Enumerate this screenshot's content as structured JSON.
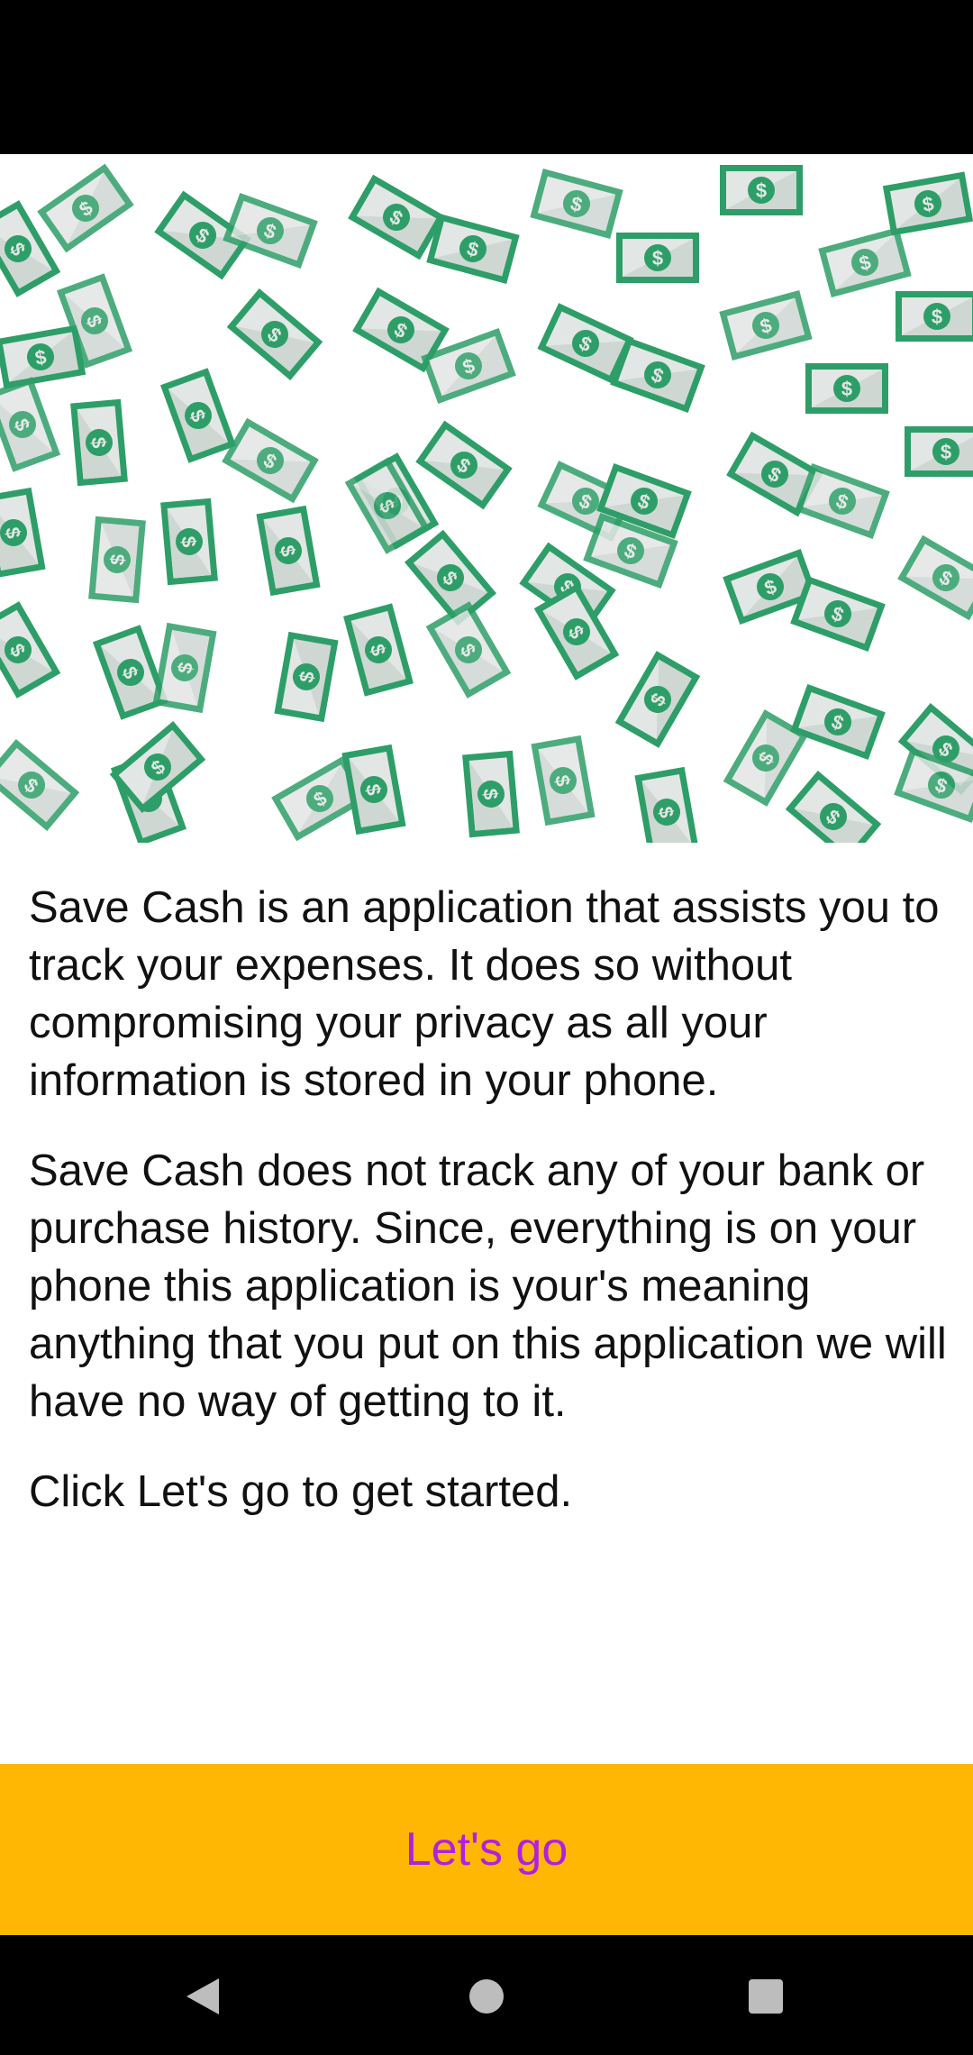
{
  "status_bar": {},
  "hero": {
    "illustration": "money-bills-illustration",
    "bill_symbol": "$",
    "colors": {
      "bill_green": "#2E9E68",
      "bill_light": "#7CC9A2",
      "bill_face": "#E2E6E4"
    }
  },
  "content": {
    "paragraphs": [
      "Save Cash is an application that assists you to track your expenses. It does so without compromising your privacy as all your information is stored in your phone.",
      "Save Cash does not track any of your bank or purchase history. Since, everything is on your phone this application is your's meaning anything that you put on this application we will have no way of getting to it.",
      "Click Let's go to get started."
    ]
  },
  "cta": {
    "label": "Let's go",
    "background": "#FFB703",
    "text_color": "#B21FE0"
  },
  "nav_bar": {
    "back_icon": "back-triangle-icon",
    "home_icon": "home-circle-icon",
    "recents_icon": "recents-square-icon"
  }
}
